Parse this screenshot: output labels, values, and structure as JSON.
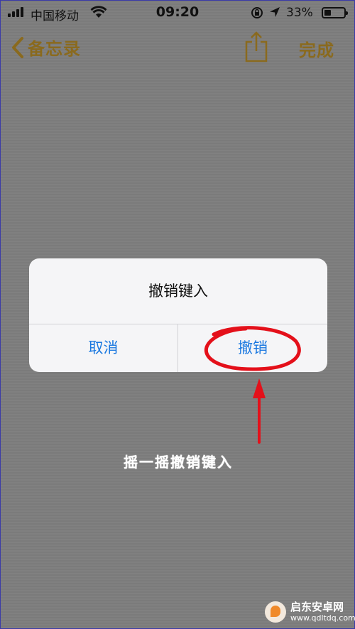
{
  "status_bar": {
    "carrier": "中国移动",
    "time": "09:20",
    "battery_percent": "33%",
    "battery_level": 0.33
  },
  "nav": {
    "back_label": "备忘录",
    "done_label": "完成"
  },
  "alert": {
    "title": "撤销键入",
    "cancel_label": "取消",
    "undo_label": "撤销"
  },
  "annotation": {
    "caption": "摇一摇撤销键入",
    "color": "#e4101a"
  },
  "watermark": {
    "name": "启东安卓网",
    "url": "www.qdltdq.com"
  },
  "colors": {
    "accent": "#8a6a1e",
    "alert_button": "#1a78e0"
  }
}
